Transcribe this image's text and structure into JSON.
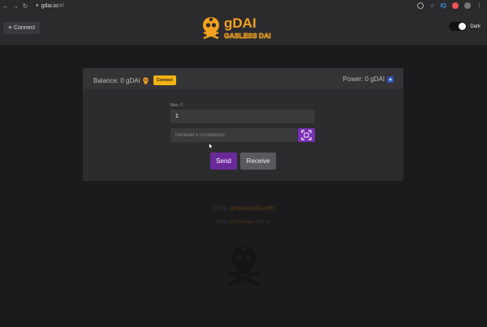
{
  "browser": {
    "url_host": "gdai.io",
    "url_path": "/#/",
    "back_glyph": "←",
    "forward_glyph": "→",
    "reload_glyph": "↻",
    "lock_glyph": "🔒",
    "ext_label": "IQ",
    "menu_glyph": "⋮"
  },
  "header": {
    "connect_label": "Connect",
    "logo_text_top": "gDAI",
    "logo_text_bottom": "GASLESS DAI",
    "dark_label": "Dark"
  },
  "card": {
    "balance_label": "Balance: 0 gDAI",
    "balance_connect_label": "Connect",
    "power_label": "Power: 0 gDAI",
    "max_label": "Max: 0",
    "amount_value": "1",
    "address_placeholder": "Receiver ETH Address",
    "send_label": "Send",
    "receive_label": "Receive"
  },
  "footer": {
    "ens_prefix": "ENS: ",
    "ens_name": "gaslessdai.eth",
    "built_prefix": "BUIDL ",
    "built_handle": "@ETHBuidler",
    "built_suffix": " 2019 by"
  },
  "colors": {
    "accent_orange": "#f4b312",
    "accent_purple": "#6b2a9a",
    "background": "#1b1b1d"
  }
}
